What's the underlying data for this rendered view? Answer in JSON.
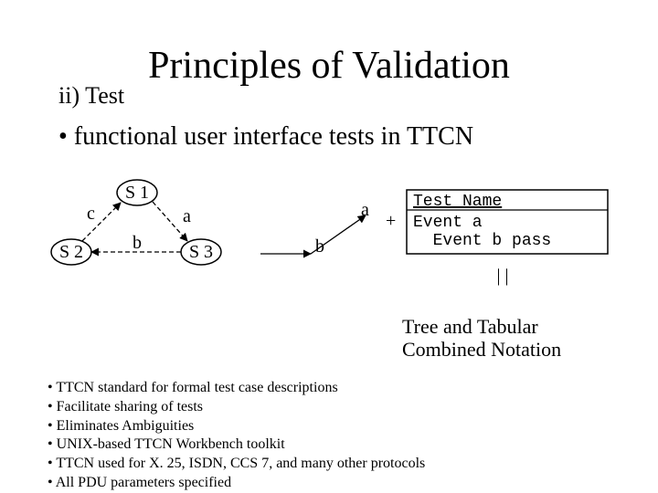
{
  "title": "Principles of Validation",
  "subhead": "ii) Test",
  "bullet_main": "•  functional user interface tests in TTCN",
  "graph": {
    "s1": "S 1",
    "s2": "S 2",
    "s3": "S 3",
    "a": "a",
    "b": "b",
    "c": "c"
  },
  "tree": {
    "a": "a",
    "b": "b",
    "plus": "+"
  },
  "table": {
    "header": "Test Name",
    "line1": "Event a",
    "line2": "  Event b pass"
  },
  "pipes": "|  |",
  "caption_l1": "Tree and Tabular",
  "caption_l2": "Combined Notation",
  "bullets": [
    "TTCN standard for formal test case descriptions",
    "Facilitate sharing of tests",
    "Eliminates Ambiguities",
    "UNIX-based TTCN Workbench toolkit",
    "TTCN used for X. 25, ISDN, CCS 7, and many other protocols",
    "All PDU parameters specified"
  ]
}
